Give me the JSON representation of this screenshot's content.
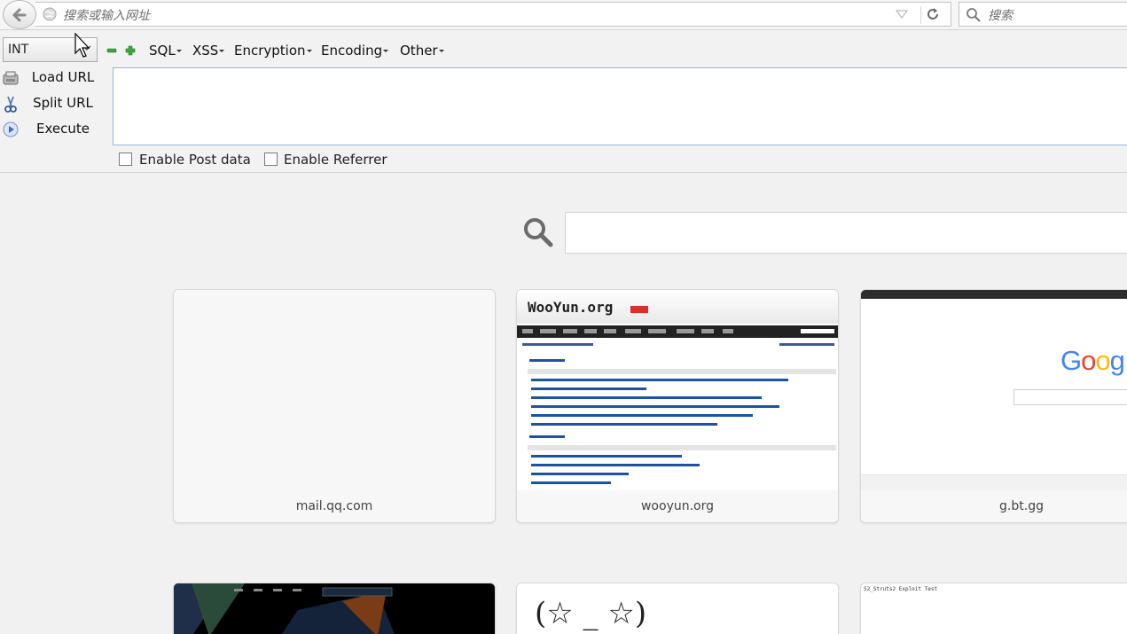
{
  "navbar": {
    "url_placeholder": "搜索或输入网址",
    "search_placeholder": "搜索"
  },
  "hackbar": {
    "type_select": "INT",
    "menus": [
      "SQL",
      "XSS",
      "Encryption",
      "Encoding",
      "Other"
    ],
    "actions": {
      "load": "Load URL",
      "split": "Split URL",
      "execute": "Execute"
    },
    "enable_post": "Enable Post data",
    "enable_referrer": "Enable Referrer"
  },
  "tiles": {
    "t1": "mail.qq.com",
    "t2": "wooyun.org",
    "t3": "g.bt.gg"
  },
  "wooyun": {
    "logo": "WooYun.org"
  },
  "google": {
    "logo": "Goog"
  },
  "bottom_tiles": {
    "struts": "S2_Struts2 Exploit Test",
    "stars": "(☆ _ ☆)"
  },
  "colors": {
    "accent_border": "#92b7e2",
    "google_blue": "#4285f4",
    "google_red": "#ea4335",
    "google_yellow": "#fbbc05",
    "google_green": "#34a853"
  }
}
